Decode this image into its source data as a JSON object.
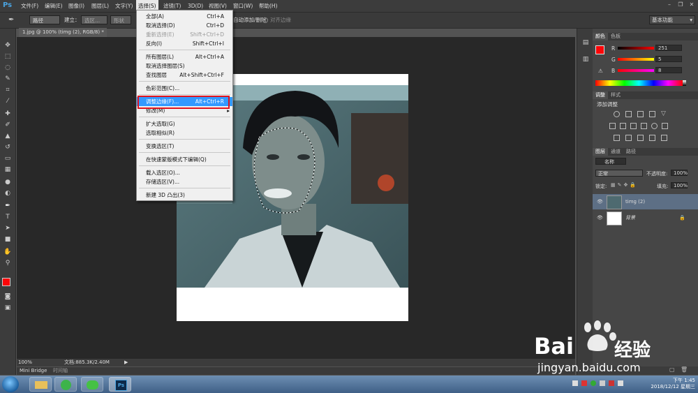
{
  "menubar": {
    "logo": "Ps",
    "items": [
      "文件(F)",
      "编辑(E)",
      "图像(I)",
      "图层(L)",
      "文字(Y)",
      "选择(S)",
      "滤镜(T)",
      "3D(D)",
      "视图(V)",
      "窗口(W)",
      "帮助(H)"
    ]
  },
  "options": {
    "path_mode": "路径",
    "make_label": "建立：",
    "selection_btn": "选区...",
    "shape_btn": "形状",
    "auto_add_delete": "自动添加/删除",
    "align_edges": "对齐边缘",
    "workspace": "基本功能"
  },
  "document": {
    "tab": "1.jpg @ 100% (timg (2), RGB/8) *",
    "zoom": "100%",
    "doc_info": "文档:885.3K/2.40M",
    "bridge": "Mini Bridge",
    "timeline": "时间轴"
  },
  "select_menu": {
    "items": [
      {
        "label": "全部(A)",
        "shortcut": "Ctrl+A",
        "disabled": false
      },
      {
        "label": "取消选择(D)",
        "shortcut": "Ctrl+D",
        "disabled": false
      },
      {
        "label": "重新选择(E)",
        "shortcut": "Shift+Ctrl+D",
        "disabled": true
      },
      {
        "label": "反向(I)",
        "shortcut": "Shift+Ctrl+I",
        "disabled": false
      },
      {
        "label": "所有图层(L)",
        "shortcut": "Alt+Ctrl+A",
        "disabled": false
      },
      {
        "label": "取消选择图层(S)",
        "shortcut": "",
        "disabled": false
      },
      {
        "label": "查找图层",
        "shortcut": "Alt+Shift+Ctrl+F",
        "disabled": false
      },
      {
        "label": "色彩范围(C)...",
        "shortcut": "",
        "disabled": false
      },
      {
        "label": "调整边缘(F)...",
        "shortcut": "Alt+Ctrl+R",
        "disabled": false
      },
      {
        "label": "修改(M)",
        "shortcut": "",
        "disabled": false
      },
      {
        "label": "扩大选取(G)",
        "shortcut": "",
        "disabled": false
      },
      {
        "label": "选取相似(R)",
        "shortcut": "",
        "disabled": false
      },
      {
        "label": "变换选区(T)",
        "shortcut": "",
        "disabled": false
      },
      {
        "label": "在快速蒙版模式下编辑(Q)",
        "shortcut": "",
        "disabled": false
      },
      {
        "label": "载入选区(O)...",
        "shortcut": "",
        "disabled": false
      },
      {
        "label": "存储选区(V)...",
        "shortcut": "",
        "disabled": false
      },
      {
        "label": "新建 3D 凸出(3)",
        "shortcut": "",
        "disabled": false
      }
    ]
  },
  "color_panel": {
    "tabs": [
      "颜色",
      "色板"
    ],
    "r_label": "R",
    "g_label": "G",
    "b_label": "B",
    "r": "251",
    "g": "5",
    "b": "8",
    "foreground": "#fb0508"
  },
  "adjust_panel": {
    "tabs": [
      "调整",
      "样式"
    ],
    "title": "添加调整"
  },
  "layers_panel": {
    "tabs": [
      "图层",
      "通道",
      "路径"
    ],
    "filter": "名称",
    "blend": "正常",
    "opacity_label": "不透明度:",
    "opacity": "100%",
    "lock_label": "锁定:",
    "fill_label": "填充:",
    "fill": "100%",
    "layers": [
      {
        "name": "timg (2)",
        "selected": true
      },
      {
        "name": "背景",
        "selected": false
      }
    ]
  },
  "taskbar": {
    "time": "下午 1:45",
    "date": "2018/12/12 星期三"
  },
  "watermark": {
    "brand": "Bai",
    "brand2": "经验",
    "url": "jingyan.baidu.com"
  }
}
